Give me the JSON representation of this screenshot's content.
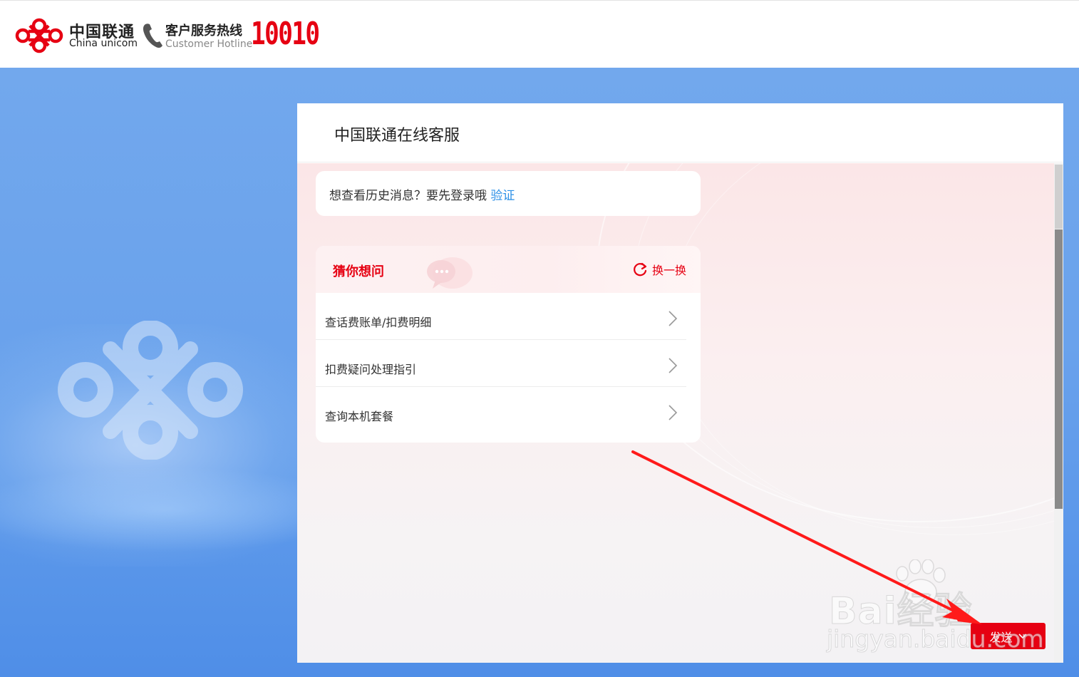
{
  "header": {
    "brand_cn": "中国联通",
    "brand_en": "China unicom",
    "hotline_cn": "客户服务热线",
    "hotline_en": "Customer Hotline",
    "hotline_number": "10010"
  },
  "panel": {
    "title": "中国联通在线客服"
  },
  "history_notice": {
    "text": "想查看历史消息？要先登录哦",
    "link_label": "验证"
  },
  "guess": {
    "title": "猜你想问",
    "refresh_label": "换一换",
    "items": [
      {
        "label": "查话费账单/扣费明细"
      },
      {
        "label": "扣费疑问处理指引"
      },
      {
        "label": "查询本机套餐"
      }
    ]
  },
  "composer": {
    "send_label": "发送"
  },
  "watermark": {
    "text": "Bai经验",
    "url": "jingyan.baidu.com"
  },
  "colors": {
    "brand_red": "#e60012",
    "link_blue": "#2b8fe6",
    "background_blue": "#6aa6ec"
  }
}
